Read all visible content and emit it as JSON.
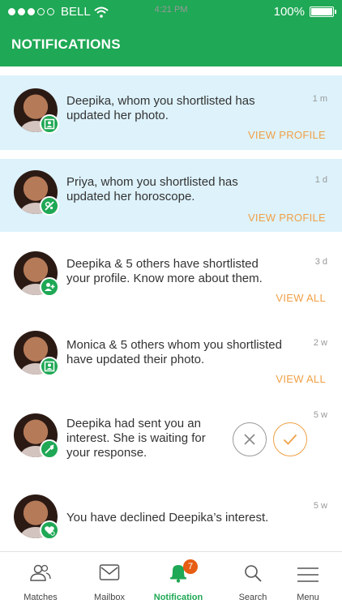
{
  "status_bar": {
    "carrier": "BELL",
    "time": "4:21 PM",
    "battery": "100%"
  },
  "header": {
    "title": "NOTIFICATIONS"
  },
  "notifications": [
    {
      "message": "Deepika, whom you shortlisted has updated her photo.",
      "time": "1 m",
      "action": "VIEW PROFILE",
      "badge": "photo-icon"
    },
    {
      "message": "Priya, whom you shortlisted has updated her horoscope.",
      "time": "1 d",
      "action": "VIEW PROFILE",
      "badge": "horoscope-icon"
    },
    {
      "message": "Deepika & 5 others have shortlisted your profile. Know more about them.",
      "time": "3 d",
      "action": "VIEW ALL",
      "badge": "add-person-icon"
    },
    {
      "message": "Monica & 5 others whom you shortlisted have updated their photo.",
      "time": "2 w",
      "action": "VIEW ALL",
      "badge": "photo-icon"
    },
    {
      "message": "Deepika had sent you an interest. She is waiting for your response.",
      "time": "5 w",
      "badge": "interest-icon"
    },
    {
      "message": "You have declined Deepika’s interest.",
      "time": "5 w",
      "badge": "declined-heart-icon"
    }
  ],
  "tabs": [
    {
      "label": "Matches",
      "icon": "people-icon"
    },
    {
      "label": "Mailbox",
      "icon": "mail-icon"
    },
    {
      "label": "Notification",
      "icon": "bell-icon",
      "badge": "7"
    },
    {
      "label": "Search",
      "icon": "search-icon"
    },
    {
      "label": "Menu",
      "icon": "menu-icon"
    }
  ],
  "colors": {
    "brand": "#1fa855",
    "accent": "#f0a046",
    "highlight": "#ddf2fb",
    "badge": "#e65d13"
  }
}
